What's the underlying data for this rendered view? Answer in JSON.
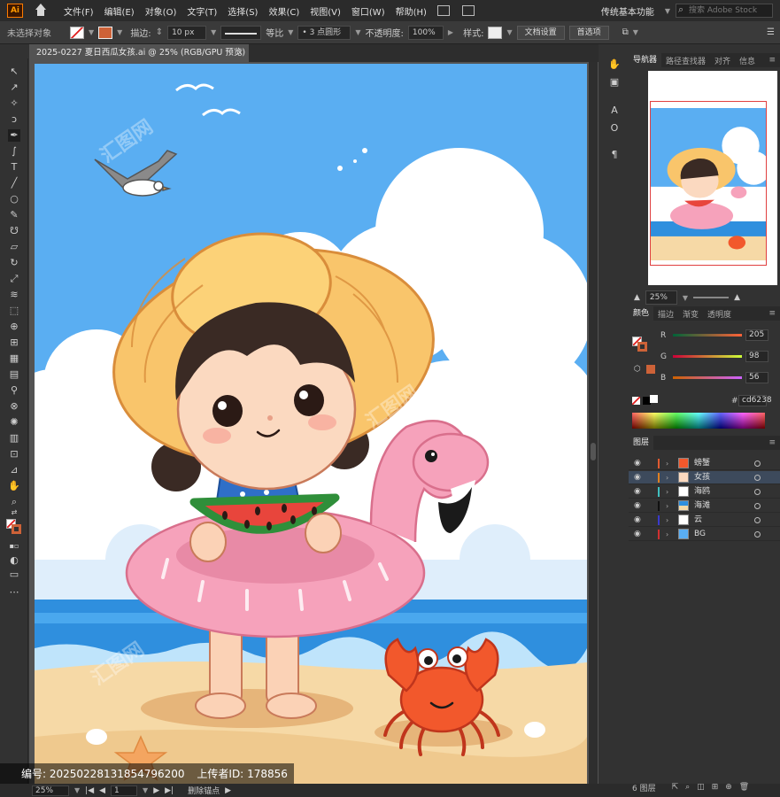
{
  "app": {
    "logo": "Ai"
  },
  "menu": [
    "文件(F)",
    "编辑(E)",
    "对象(O)",
    "文字(T)",
    "选择(S)",
    "效果(C)",
    "视图(V)",
    "窗口(W)",
    "帮助(H)"
  ],
  "workspace": {
    "name": "传统基本功能",
    "search_placeholder": "搜索 Adobe Stock"
  },
  "control": {
    "selection": "未选择对象",
    "stroke_label": "描边:",
    "stroke_value": "10 px",
    "stroke_profile": "等比",
    "brush": "3 点圆形",
    "opacity_label": "不透明度:",
    "opacity_value": "100%",
    "style_label": "样式:",
    "doc_setup": "文档设置",
    "prefs": "首选项",
    "stroke_color": "#cd6238"
  },
  "document": {
    "tab_title": "2025-0227 夏日西瓜女孩.ai @ 25% (RGB/GPU 预览)",
    "close": "×"
  },
  "status": {
    "zoom": "25%",
    "page": "1",
    "tool_hint": "删除锚点"
  },
  "info_bar": {
    "id_label": "编号:",
    "id": "20250228131854796200",
    "uploader_label": "上传者ID:",
    "uploader_id": "178856"
  },
  "watermark": "汇图网",
  "navigator": {
    "tabs": [
      "导航器",
      "路径查找器",
      "对齐",
      "信息"
    ],
    "zoom": "25%"
  },
  "color": {
    "tabs": [
      "颜色",
      "描边",
      "渐变",
      "透明度"
    ],
    "r": {
      "label": "R",
      "value": "205"
    },
    "g": {
      "label": "G",
      "value": "98"
    },
    "b": {
      "label": "B",
      "value": "56"
    },
    "hex_label": "#",
    "hex": "cd6238"
  },
  "layers": {
    "title": "图层",
    "items": [
      {
        "name": "螃蟹",
        "color": "#e05a30",
        "selected": false
      },
      {
        "name": "女孩",
        "color": "#e08020",
        "selected": true
      },
      {
        "name": "海鸥",
        "color": "#40c0c0",
        "selected": false
      },
      {
        "name": "海滩",
        "color": "#111111",
        "selected": false
      },
      {
        "name": "云",
        "color": "#3a3acc",
        "selected": false
      },
      {
        "name": "BG",
        "color": "#d03030",
        "selected": false
      }
    ],
    "count": "6 图层"
  }
}
